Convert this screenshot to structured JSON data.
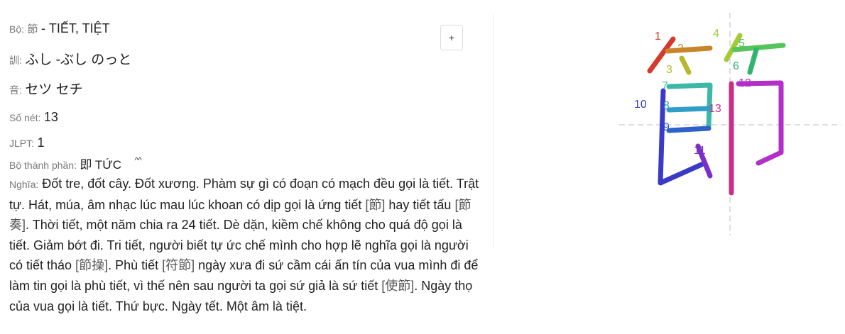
{
  "kanji": {
    "radical": {
      "label": "Bộ:",
      "char": "節",
      "reading": "- TIẾT, TIỆT"
    },
    "kun": {
      "label": "訓:",
      "value": "ふし -ぶし のっと"
    },
    "on": {
      "label": "音:",
      "value": "セツ セチ"
    },
    "strokes": {
      "label": "Số nét:",
      "value": "13"
    },
    "jlpt": {
      "label": "JLPT:",
      "value": "1"
    },
    "components": {
      "label": "Bộ thành phần:",
      "char": "即",
      "reading": "TỨC",
      "extra": "^^"
    },
    "meaning": {
      "label": "Nghĩa:",
      "parts": [
        "Đốt tre, đốt cây. Đốt xương. Phàm sự gì có đoạn có mạch đều gọi là tiết. Trật tự. Hát, múa, âm nhạc lúc mau lúc khoan có dịp gọi là ứng tiết ",
        "[節]",
        " hay tiết tấu ",
        "[節奏]",
        ". Thời tiết, một năm chia ra 24 tiết. Dè dặn, kiềm chế không cho quá độ gọi là tiết. Giảm bớt đi. Tri tiết, người biết tự ức chế mình cho hợp lẽ nghĩa gọi là người có tiết tháo ",
        "[節操]",
        ". Phù tiết ",
        "[符節]",
        " ngày xưa đi sứ cầm cái ấn tín của vua mình đi để làm tin gọi là phù tiết, vì thế nên sau người ta gọi sứ giả là sứ tiết ",
        "[使節]",
        ". Ngày thọ của vua gọi là tiết. Thứ bực. Ngày tết. Một âm là tiệt."
      ]
    }
  },
  "toolbar": {
    "add_label": "+"
  },
  "stroke_order": {
    "numbers": [
      "1",
      "2",
      "3",
      "4",
      "5",
      "6",
      "7",
      "8",
      "9",
      "10",
      "11",
      "12",
      "13"
    ],
    "colors": [
      "#d33a2c",
      "#c9852a",
      "#b8b82a",
      "#a6c936",
      "#55c45a",
      "#2fb56f",
      "#3cb8a6",
      "#2f9ec9",
      "#2f62c9",
      "#3a3ac9",
      "#7a2fc9",
      "#b22fc9",
      "#c92f86"
    ]
  }
}
